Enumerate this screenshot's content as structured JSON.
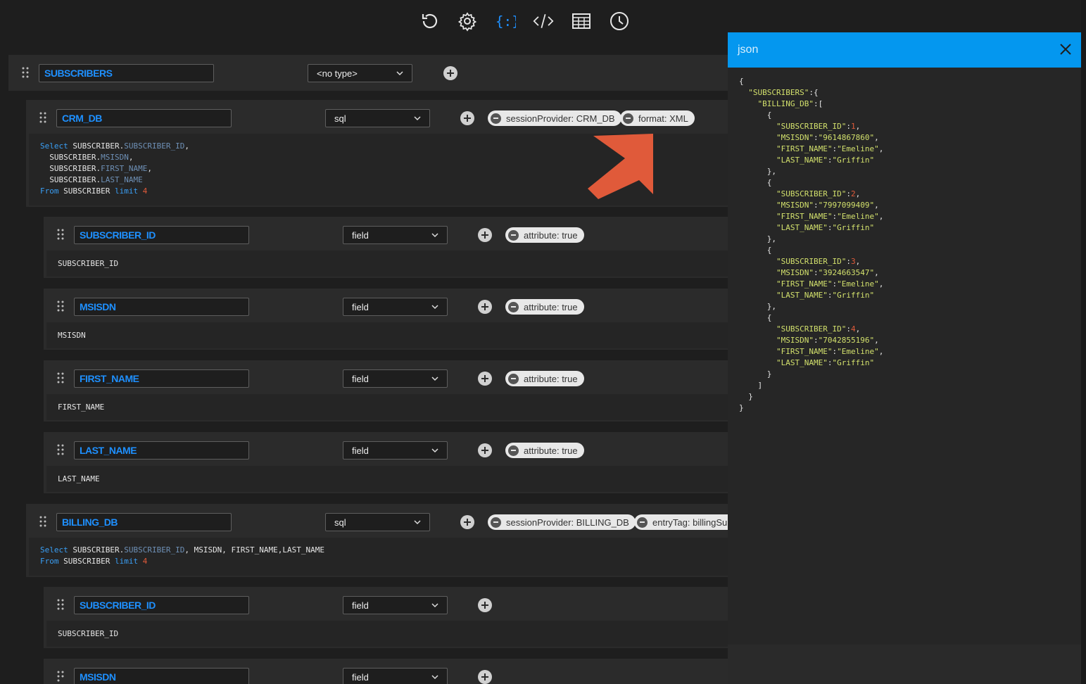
{
  "toolbar": {
    "buttons": [
      {
        "icon": "refresh-icon"
      },
      {
        "icon": "settings-icon"
      },
      {
        "icon": "json-icon",
        "active": true
      },
      {
        "icon": "code-icon"
      },
      {
        "icon": "table-icon"
      },
      {
        "icon": "history-icon"
      }
    ],
    "accent": "#1e90ff"
  },
  "root_node": {
    "name": "SUBSCRIBERS",
    "type": "<no type>"
  },
  "crm_node": {
    "name": "CRM_DB",
    "type": "sql",
    "chips": [
      "sessionProvider: CRM_DB",
      "format: XML"
    ],
    "sql": {
      "select": "Select",
      "table": "SUBSCRIBER",
      "from": "From",
      "limit": "limit",
      "limit_value": "4",
      "cols": [
        "SUBSCRIBER_ID",
        "MSISDN",
        "FIRST_NAME",
        "LAST_NAME"
      ]
    },
    "fields": [
      {
        "name": "SUBSCRIBER_ID",
        "type": "field",
        "chip": "attribute: true",
        "body": "SUBSCRIBER_ID"
      },
      {
        "name": "MSISDN",
        "type": "field",
        "chip": "attribute: true",
        "body": "MSISDN"
      },
      {
        "name": "FIRST_NAME",
        "type": "field",
        "chip": "attribute: true",
        "body": "FIRST_NAME"
      },
      {
        "name": "LAST_NAME",
        "type": "field",
        "chip": "attribute: true",
        "body": "LAST_NAME"
      }
    ]
  },
  "billing_node": {
    "name": "BILLING_DB",
    "type": "sql",
    "chips": [
      "sessionProvider: BILLING_DB",
      "entryTag: billingSub"
    ],
    "sql": {
      "line1_a": "Select",
      "line1_b": "SUBSCRIBER.",
      "line1_c": "SUBSCRIBER_ID",
      "line1_d": ", MSISDN, FIRST_NAME,LAST_NAME",
      "line2_a": "From",
      "line2_b": "SUBSCRIBER",
      "line2_c": "limit",
      "line2_d": "4"
    },
    "fields": [
      {
        "name": "SUBSCRIBER_ID",
        "type": "field",
        "body": "SUBSCRIBER_ID"
      },
      {
        "name": "MSISDN",
        "type": "field"
      }
    ]
  },
  "json_panel": {
    "title": "json",
    "header_color": "#0497ef",
    "root_key": "SUBSCRIBERS",
    "db_key": "BILLING_DB",
    "records": [
      {
        "SUBSCRIBER_ID": "1",
        "MSISDN": "9614867860",
        "FIRST_NAME": "Emeline",
        "LAST_NAME": "Griffin"
      },
      {
        "SUBSCRIBER_ID": "2",
        "MSISDN": "7997099409",
        "FIRST_NAME": "Emeline",
        "LAST_NAME": "Griffin"
      },
      {
        "SUBSCRIBER_ID": "3",
        "MSISDN": "3924663547",
        "FIRST_NAME": "Emeline",
        "LAST_NAME": "Griffin"
      },
      {
        "SUBSCRIBER_ID": "4",
        "MSISDN": "7042855196",
        "FIRST_NAME": "Emeline",
        "LAST_NAME": "Griffin"
      }
    ]
  },
  "annotation_arrow_color": "#e05a3a"
}
